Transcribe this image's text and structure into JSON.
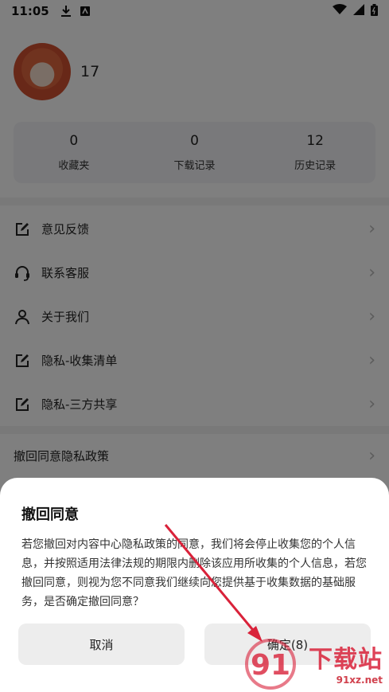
{
  "status_bar": {
    "time": "11:05",
    "icons": [
      "download-icon",
      "app-notification-icon",
      "wifi-icon",
      "signal-icon",
      "battery-icon"
    ]
  },
  "profile": {
    "username": "17"
  },
  "stats": [
    {
      "value": "0",
      "label": "收藏夹"
    },
    {
      "value": "0",
      "label": "下载记录"
    },
    {
      "value": "12",
      "label": "历史记录"
    }
  ],
  "menu": [
    {
      "label": "意见反馈",
      "icon": "edit-icon"
    },
    {
      "label": "联系客服",
      "icon": "headset-icon"
    },
    {
      "label": "关于我们",
      "icon": "person-icon"
    },
    {
      "label": "隐私-收集清单",
      "icon": "edit-icon"
    },
    {
      "label": "隐私-三方共享",
      "icon": "edit-icon"
    },
    {
      "label": "撤回同意隐私政策",
      "icon": ""
    }
  ],
  "dialog": {
    "title": "撤回同意",
    "message": "若您撤回对内容中心隐私政策的同意，我们将会停止收集您的个人信息，并按照适用法律法规的期限内删除该应用所收集的个人信息，若您撤回同意，则视为您不同意我们继续向您提供基于收集数据的基础服务，是否确定撤回同意？",
    "cancel_label": "取消",
    "confirm_label": "确定(8)"
  },
  "watermark": {
    "brand": "下载站",
    "url": "91xz.net",
    "logo_number": "91"
  },
  "colors": {
    "accent_red": "#d9223a",
    "overlay": "rgba(0,0,0,0.5)",
    "card_bg": "#f2f3f6",
    "button_bg": "#ededed"
  }
}
